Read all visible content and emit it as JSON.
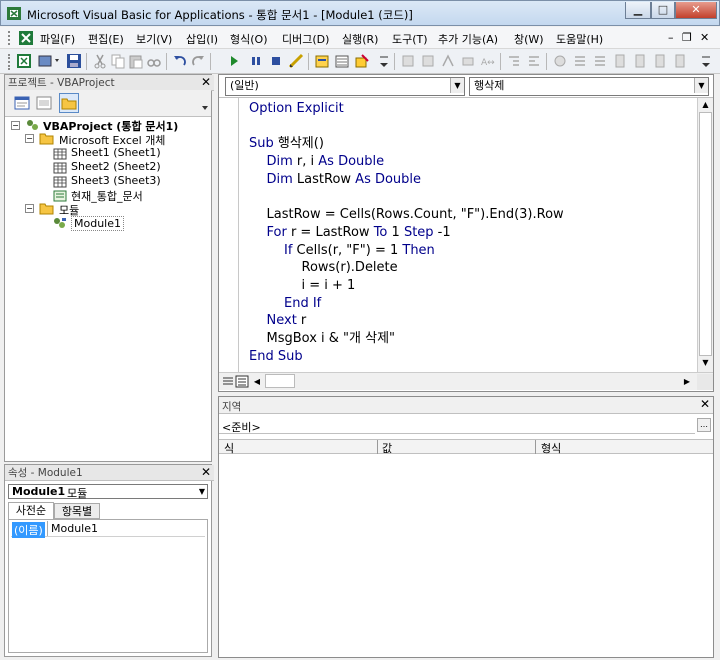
{
  "window": {
    "title": "Microsoft Visual Basic for Applications - 통합 문서1 - [Module1 (코드)]",
    "controls": {
      "minimize": "▁",
      "maximize": "□",
      "close": "✕"
    }
  },
  "menu": {
    "items": [
      "파일(F)",
      "편집(E)",
      "보기(V)",
      "삽입(I)",
      "형식(O)",
      "디버그(D)",
      "실행(R)",
      "도구(T)",
      "추가 기능(A)",
      "창(W)",
      "도움말(H)"
    ],
    "doc_controls": {
      "minimize": "–",
      "restore": "❐",
      "close": "✕"
    }
  },
  "project": {
    "title": "프로젝트 - VBAProject",
    "tree": {
      "root": "VBAProject (통합 문서1)",
      "excel_objects": "Microsoft Excel 개체",
      "sheets": [
        "Sheet1 (Sheet1)",
        "Sheet2 (Sheet2)",
        "Sheet3 (Sheet3)"
      ],
      "workbook": "현재_통합_문서",
      "modules_folder": "모듈",
      "modules": [
        "Module1"
      ]
    }
  },
  "properties": {
    "title": "속성 - Module1",
    "object_name": "Module1",
    "object_type": "모듈",
    "tabs": [
      "사전순",
      "항목별"
    ],
    "rows": [
      {
        "name": "(이름)",
        "value": "Module1"
      }
    ]
  },
  "code": {
    "object_combo": "(일반)",
    "proc_combo": "행삭제",
    "lines": [
      {
        "indent": 0,
        "parts": [
          {
            "t": "Option Explicit",
            "k": true
          }
        ]
      },
      {
        "indent": 0,
        "parts": []
      },
      {
        "indent": 0,
        "parts": [
          {
            "t": "Sub ",
            "k": true
          },
          {
            "t": "행삭제()",
            "k": false
          }
        ]
      },
      {
        "indent": 1,
        "parts": [
          {
            "t": "Dim ",
            "k": true
          },
          {
            "t": "r, i ",
            "k": false
          },
          {
            "t": "As Double",
            "k": true
          }
        ]
      },
      {
        "indent": 1,
        "parts": [
          {
            "t": "Dim ",
            "k": true
          },
          {
            "t": "LastRow ",
            "k": false
          },
          {
            "t": "As Double",
            "k": true
          }
        ]
      },
      {
        "indent": 0,
        "parts": []
      },
      {
        "indent": 1,
        "parts": [
          {
            "t": "LastRow = Cells(Rows.Count, \"F\").End(3).Row",
            "k": false
          }
        ]
      },
      {
        "indent": 1,
        "parts": [
          {
            "t": "For ",
            "k": true
          },
          {
            "t": "r = LastRow ",
            "k": false
          },
          {
            "t": "To ",
            "k": true
          },
          {
            "t": "1 ",
            "k": false
          },
          {
            "t": "Step ",
            "k": true
          },
          {
            "t": "-1",
            "k": false
          }
        ]
      },
      {
        "indent": 2,
        "parts": [
          {
            "t": "If ",
            "k": true
          },
          {
            "t": "Cells(r, \"F\") = 1 ",
            "k": false
          },
          {
            "t": "Then",
            "k": true
          }
        ]
      },
      {
        "indent": 3,
        "parts": [
          {
            "t": "Rows(r).Delete",
            "k": false
          }
        ]
      },
      {
        "indent": 3,
        "parts": [
          {
            "t": "i = i + 1",
            "k": false
          }
        ]
      },
      {
        "indent": 2,
        "parts": [
          {
            "t": "End If",
            "k": true
          }
        ]
      },
      {
        "indent": 1,
        "parts": [
          {
            "t": "Next ",
            "k": true
          },
          {
            "t": "r",
            "k": false
          }
        ]
      },
      {
        "indent": 1,
        "parts": [
          {
            "t": "MsgBox i & \"개 삭제\"",
            "k": false
          }
        ]
      },
      {
        "indent": 0,
        "parts": [
          {
            "t": "End Sub",
            "k": true
          }
        ]
      }
    ]
  },
  "locals": {
    "title": "지역",
    "status": "<준비>",
    "columns": [
      "식",
      "값",
      "형식"
    ]
  },
  "colors": {
    "keyword": "#00008b",
    "selection": "#3399ff",
    "text": "#000000"
  }
}
